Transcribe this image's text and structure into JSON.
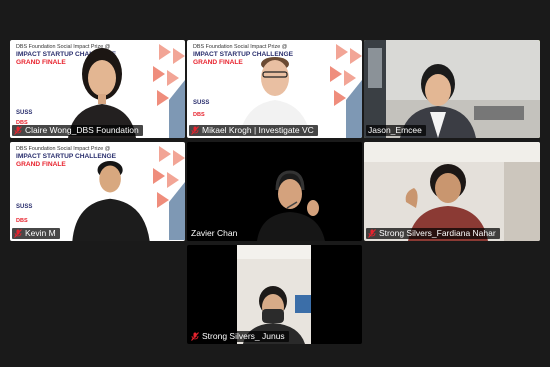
{
  "brand": {
    "prize_line": "DBS Foundation Social Impact Prize @",
    "challenge_line": "IMPACT STARTUP CHALLENGE",
    "finale_line": "GRAND FINALE",
    "suss_logo": "SUSS",
    "dbs_logo": "DBS"
  },
  "participants": [
    {
      "name": "Claire Wong_DBS Foundation",
      "muted": true,
      "background": "brand"
    },
    {
      "name": "Mikael Krogh | Investigate VC",
      "muted": true,
      "background": "brand"
    },
    {
      "name": "Jason_Emcee",
      "muted": false,
      "background": "office",
      "active_speaker": true
    },
    {
      "name": "Kevin M",
      "muted": true,
      "background": "brand"
    },
    {
      "name": "Zavier Chan",
      "muted": false,
      "background": "dark"
    },
    {
      "name": "Strong Silvers_Fardiana Nahar",
      "muted": true,
      "background": "room"
    },
    {
      "name": "Strong Silvers_ Junus",
      "muted": true,
      "background": "room"
    }
  ],
  "colors": {
    "active_speaker_border": "#c6e13a",
    "mute_icon": "#e8232e",
    "brand_navy": "#2a2f6e",
    "brand_red": "#e8232e"
  },
  "icons": {
    "muted": "microphone-muted-icon"
  }
}
